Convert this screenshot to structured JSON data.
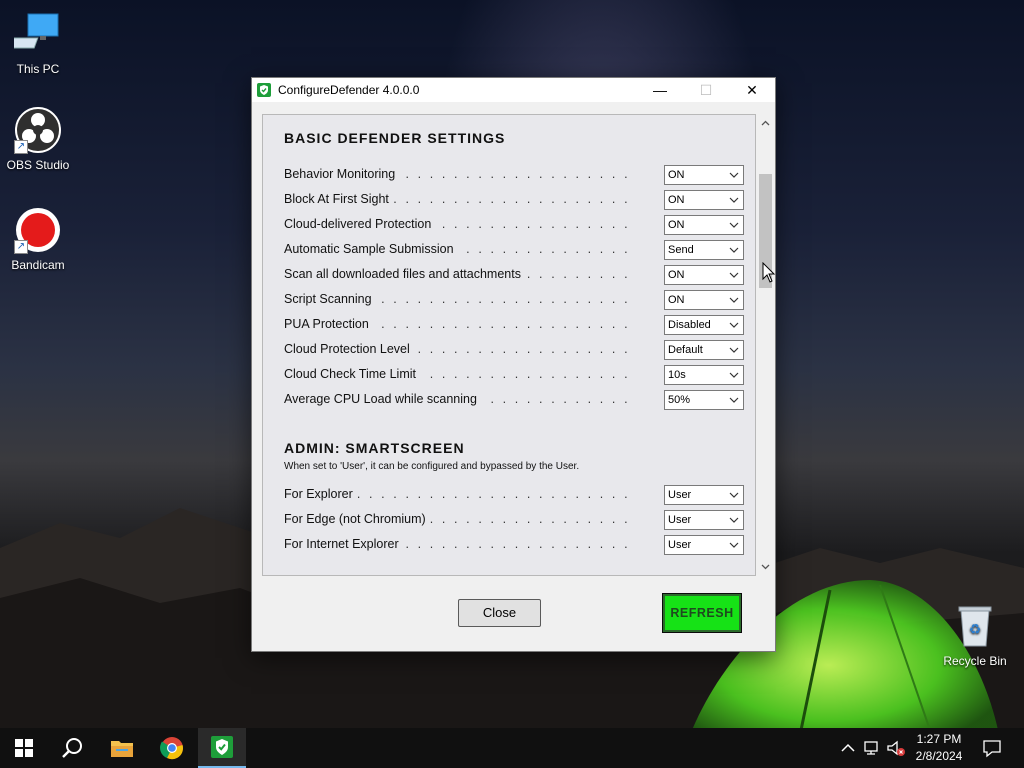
{
  "desktop": {
    "icons": [
      {
        "label": "This PC"
      },
      {
        "label": "OBS Studio"
      },
      {
        "label": "Bandicam"
      },
      {
        "label": "Recycle Bin"
      }
    ]
  },
  "window": {
    "title": "ConfigureDefender 4.0.0.0",
    "minimize_glyph": "—",
    "maximize_glyph": "☐",
    "close_glyph": "✕"
  },
  "basic": {
    "title": "BASIC DEFENDER SETTINGS",
    "rows": [
      {
        "label": "Behavior Monitoring",
        "value": "ON"
      },
      {
        "label": "Block At First Sight",
        "value": "ON"
      },
      {
        "label": "Cloud-delivered Protection",
        "value": "ON"
      },
      {
        "label": "Automatic Sample Submission",
        "value": "Send"
      },
      {
        "label": "Scan all downloaded files and attachments",
        "value": "ON"
      },
      {
        "label": "Script Scanning",
        "value": "ON"
      },
      {
        "label": "PUA Protection",
        "value": "Disabled"
      },
      {
        "label": "Cloud Protection Level",
        "value": "Default"
      },
      {
        "label": "Cloud Check Time Limit",
        "value": "10s"
      },
      {
        "label": "Average CPU Load while scanning",
        "value": "50%"
      }
    ]
  },
  "smartscreen": {
    "title": "ADMIN:  SMARTSCREEN",
    "note": "When set to 'User', it can be configured and bypassed by the User.",
    "rows": [
      {
        "label": "For Explorer",
        "value": "User"
      },
      {
        "label": "For Edge (not Chromium)",
        "value": "User"
      },
      {
        "label": "For Internet Explorer",
        "value": "User"
      }
    ]
  },
  "buttons": {
    "close_label": "Close",
    "refresh_label": "REFRESH"
  },
  "dots": ". . . . . . . . . . . . . . . . . . . . . . . . . . . . . . . . . . . . . . . . . . . . . . . . . . . . . . . . . . .",
  "taskbar": {
    "time": "1:27 PM",
    "date": "2/8/2024"
  },
  "colors": {
    "refresh_bg": "#16e216",
    "taskbar_bg": "#101010",
    "active_indicator": "#76b9ed"
  }
}
